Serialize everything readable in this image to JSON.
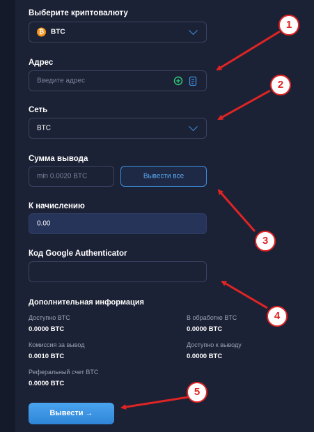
{
  "crypto": {
    "label": "Выберите криптовалюту",
    "selected": "BTC",
    "icon": "bitcoin-icon"
  },
  "address": {
    "label": "Адрес",
    "placeholder": "Введите адрес",
    "icons": [
      "plus-circle-icon",
      "clipboard-icon"
    ]
  },
  "network": {
    "label": "Сеть",
    "selected": "BTC"
  },
  "amount": {
    "label": "Сумма вывода",
    "placeholder": "min 0.0020 BTC",
    "withdraw_all_label": "Вывести все"
  },
  "credit": {
    "label": "К начислению",
    "value": "0.00"
  },
  "google_auth": {
    "label": "Код Google Authenticator",
    "value": ""
  },
  "info": {
    "title": "Дополнительная информация",
    "available_label": "Доступно BTC",
    "available_value": "0.0000 BTC",
    "processing_label": "В обработке BTC",
    "processing_value": "0.0000 BTC",
    "fee_label": "Комиссия за вывод",
    "fee_value": "0.0010 BTC",
    "withdrawable_label": "Доступно к выводу",
    "withdrawable_value": "0.0000 BTC",
    "referral_label": "Реферальный счет BTC",
    "referral_value": "0.0000 BTC"
  },
  "submit": {
    "label": "Вывести",
    "arrow": "→"
  },
  "markers": [
    "1",
    "2",
    "3",
    "4",
    "5"
  ],
  "colors": {
    "accent": "#3d8fe0",
    "marker": "#e02424",
    "background": "#1c2235"
  }
}
